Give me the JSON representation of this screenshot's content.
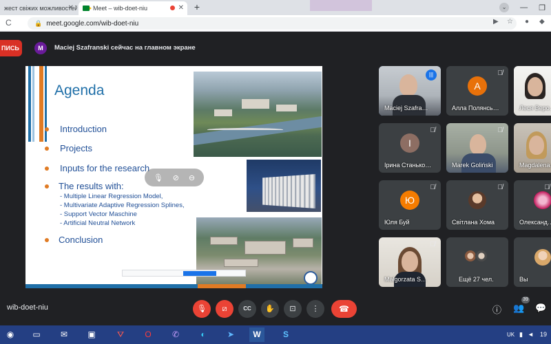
{
  "browser": {
    "tabs": [
      {
        "title": "жест свіжих можливостей"
      },
      {
        "title": "Meet – wib-doet-niu"
      }
    ],
    "url": "meet.google.com/wib-doet-niu"
  },
  "banner": {
    "record_label": "ПИСЬ",
    "presenter_initial": "M",
    "presenting_text": "Maciej Szafranski сейчас на главном экране"
  },
  "slide": {
    "title": "Agenda",
    "bullets": [
      "Introduction",
      "Projects",
      "Inputs for the research",
      "The results with:",
      "Conclusion"
    ],
    "sub_items": [
      "-   Multiple Linear Regression Model,",
      "-   Multivariate Adaptive Regression Splines,",
      "-   Support Vector Maschine",
      "-   Artificial Neutral Network"
    ]
  },
  "participants": [
    {
      "name": "Maciej Szafra…",
      "state": "speaking",
      "type": "video"
    },
    {
      "name": "Алла Полянсь…",
      "state": "muted",
      "type": "avatar",
      "initial": "А",
      "color": "#e8710a"
    },
    {
      "name": "Леся Веро…",
      "state": "none",
      "type": "video"
    },
    {
      "name": "Ірина Станько…",
      "state": "muted",
      "type": "avatar",
      "initial": "І",
      "color": "#8d6e63"
    },
    {
      "name": "Marek Goliński",
      "state": "muted",
      "type": "video"
    },
    {
      "name": "Magdalena…",
      "state": "none",
      "type": "video"
    },
    {
      "name": "Юля Буй",
      "state": "muted",
      "type": "avatar",
      "initial": "Ю",
      "color": "#f57c00"
    },
    {
      "name": "Світлана Хома",
      "state": "muted",
      "type": "photo"
    },
    {
      "name": "Олександ…",
      "state": "muted",
      "type": "photo"
    },
    {
      "name": "Małgorzata S…",
      "state": "muted",
      "type": "video"
    },
    {
      "name": "Ещё 27 чел.",
      "state": "none",
      "type": "more"
    },
    {
      "name": "Вы",
      "state": "none",
      "type": "photo"
    }
  ],
  "bottom": {
    "meeting_code": "wib-doet-niu",
    "people_count": "39"
  },
  "taskbar": {
    "language": "UK",
    "time_fragment": "19"
  },
  "colors": {
    "meet_red": "#ea4335",
    "meet_dark": "#202124",
    "tile_bg": "#3c4043",
    "slide_title": "#1f6fa8",
    "bullet_dot": "#e07b24",
    "taskbar": "#243f83"
  }
}
